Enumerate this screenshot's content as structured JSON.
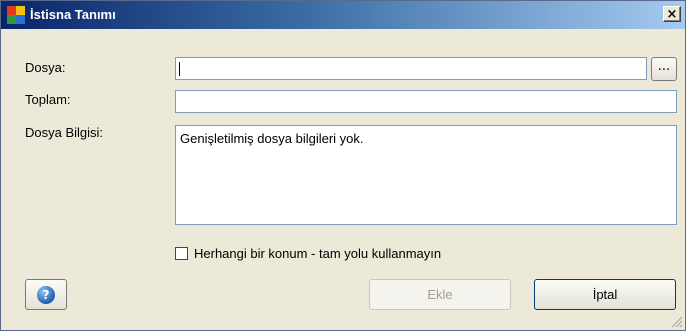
{
  "window": {
    "title": "İstisna Tanımı",
    "close_glyph": "×"
  },
  "form": {
    "file_label": "Dosya:",
    "file_value": "",
    "browse_label": "...",
    "checksum_label": "Toplam:",
    "checksum_value": "",
    "fileinfo_label": "Dosya Bilgisi:",
    "fileinfo_value": "Genişletilmiş dosya bilgileri yok.",
    "any_location_label": "Herhangi bir konum - tam yolu kullanmayın",
    "any_location_checked": false
  },
  "buttons": {
    "help_glyph": "?",
    "add_label": "Ekle",
    "add_enabled": false,
    "cancel_label": "İptal"
  },
  "icons": {
    "app": "avg-app-icon",
    "help": "help-icon",
    "resize": "resize-grip-icon"
  },
  "colors": {
    "titlebar_start": "#0a246a",
    "titlebar_end": "#a6caf0",
    "window_bg": "#ece9d8"
  }
}
